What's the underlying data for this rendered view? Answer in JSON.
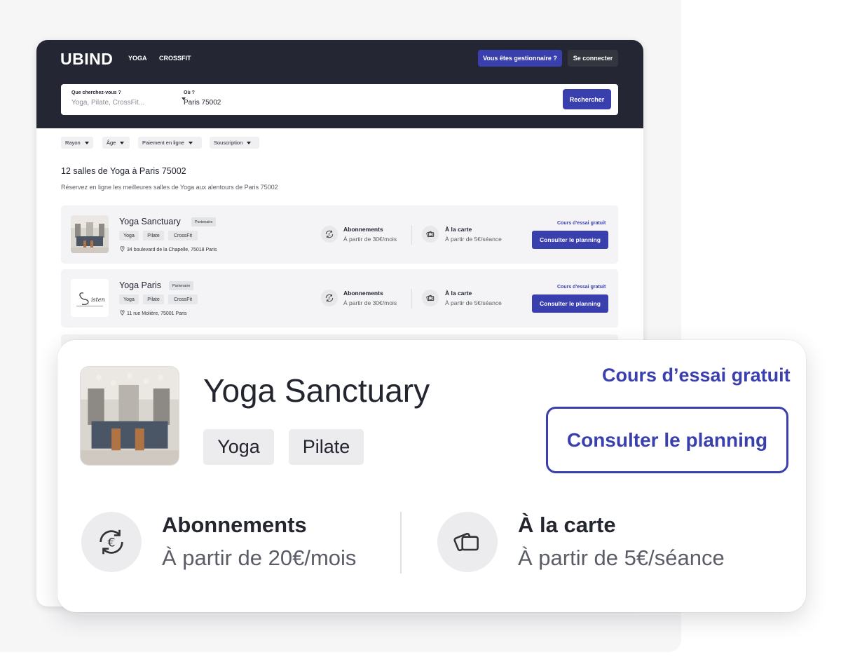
{
  "header": {
    "logo": "UBIND",
    "nav": [
      "YOGA",
      "CROSSFIT"
    ],
    "manager_button": "Vous êtes gestionnaire ?",
    "login_button": "Se connecter"
  },
  "search": {
    "what_label": "Que cherchez-vous ?",
    "what_placeholder": "Yoga, Pilate, CrossFit...",
    "where_label": "Où ?",
    "where_value": "Paris 75002",
    "button": "Rechercher"
  },
  "filters": [
    "Rayon",
    "Âge",
    "Paiement en ligne",
    "Souscription"
  ],
  "results": {
    "title": "12 salles de Yoga à Paris 75002",
    "subtitle": "Réservez en ligne les meilleures salles de Yoga aux alentours de Paris 75002"
  },
  "listings": [
    {
      "name": "Yoga Sanctuary",
      "badge": "Partenaire",
      "tags": [
        "Yoga",
        "Pilate",
        "CrossFit"
      ],
      "address": "34 boulevard de la Chapelle, 75018 Paris",
      "subscription_title": "Abonnements",
      "subscription_price": "À partir de 30€/mois",
      "single_title": "À la carte",
      "single_price": "À partir de 5€/séance",
      "trial": "Cours d'essai gratuit",
      "button": "Consulter le planning"
    },
    {
      "name": "Yoga Paris",
      "badge": "Partenaire",
      "tags": [
        "Yoga",
        "Pilate",
        "CrossFit"
      ],
      "address": "11 rue Molière, 75001 Paris",
      "subscription_title": "Abonnements",
      "subscription_price": "À partir de 30€/mois",
      "single_title": "À la carte",
      "single_price": "À partir de 5€/séance",
      "trial": "Cours d'essai gratuit",
      "button": "Consulter le planning"
    }
  ],
  "zoom_card": {
    "name": "Yoga Sanctuary",
    "tags": [
      "Yoga",
      "Pilate"
    ],
    "trial": "Cours d’essai gratuit",
    "button": "Consulter le planning",
    "subscription_title": "Abonnements",
    "subscription_price": "À partir de 20€/mois",
    "single_title": "À la carte",
    "single_price": "À partir de 5€/séance"
  },
  "icons": {
    "pin": "location-pin-icon",
    "subscription": "euro-cycle-icon",
    "single": "tickets-icon"
  },
  "colors": {
    "primary": "#3a3fae",
    "header_bg": "#242733",
    "card_bg": "#f4f4f6"
  }
}
